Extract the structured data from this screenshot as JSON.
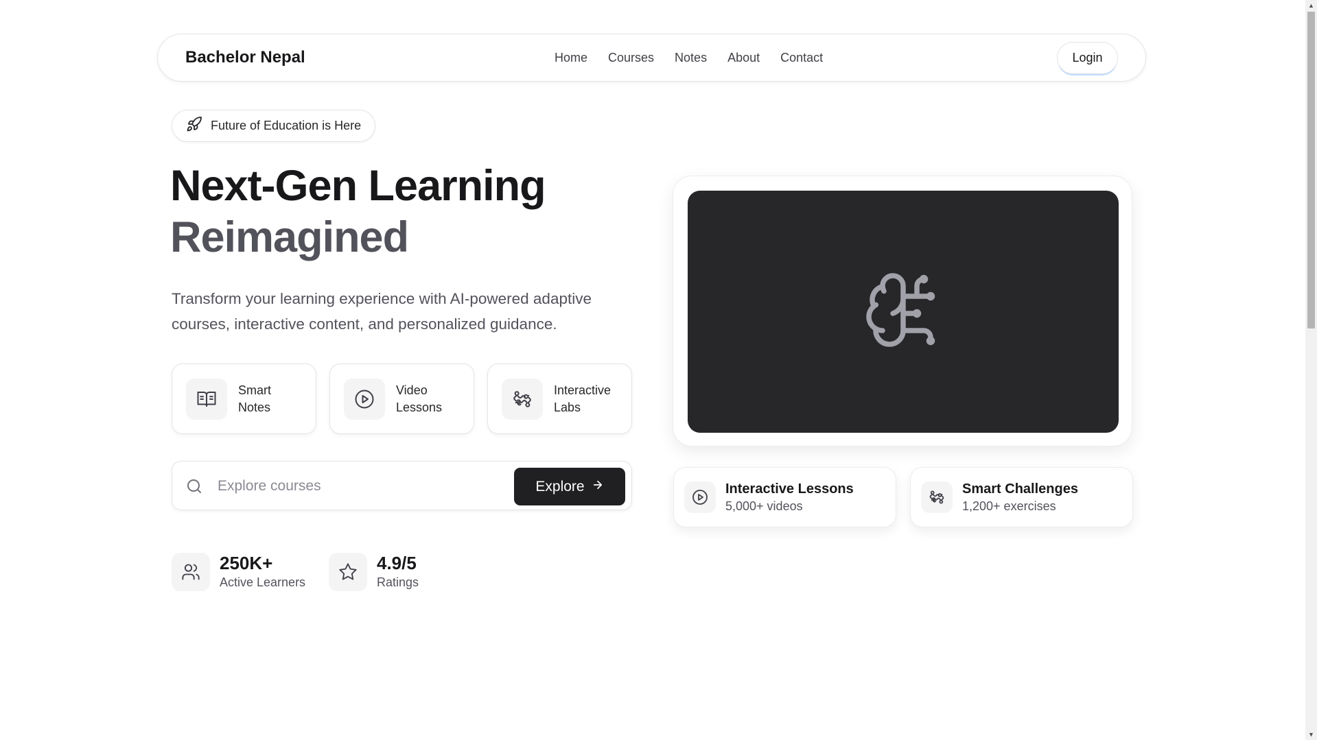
{
  "nav": {
    "brand": "Bachelor Nepal",
    "links": [
      "Home",
      "Courses",
      "Notes",
      "About",
      "Contact"
    ],
    "login": "Login"
  },
  "hero": {
    "badge": "Future of Education is Here",
    "badge_icon": "rocket-icon",
    "title_line1": "Next-Gen Learning",
    "title_line2": "Reimagined",
    "description": "Transform your learning experience with AI-powered adaptive courses, interactive content, and personalized guidance."
  },
  "features": [
    {
      "label": "Smart Notes",
      "icon": "book-open-icon"
    },
    {
      "label": "Video Lessons",
      "icon": "play-circle-icon"
    },
    {
      "label": "Interactive Labs",
      "icon": "puzzle-icon"
    }
  ],
  "search": {
    "placeholder": "Explore courses",
    "button": "Explore"
  },
  "stats": [
    {
      "value": "250K+",
      "label": "Active Learners",
      "icon": "users-icon"
    },
    {
      "value": "4.9/5",
      "label": "Ratings",
      "icon": "star-icon"
    }
  ],
  "preview": {
    "icon": "brain-circuit-icon",
    "cards": [
      {
        "title": "Interactive Lessons",
        "subtitle": "5,000+ videos",
        "icon": "play-circle-icon"
      },
      {
        "title": "Smart Challenges",
        "subtitle": "1,200+ exercises",
        "icon": "puzzle-icon"
      }
    ]
  },
  "colors": {
    "accent_dark": "#202022",
    "screen_bg": "#27272a",
    "muted_text": "#52525b"
  }
}
